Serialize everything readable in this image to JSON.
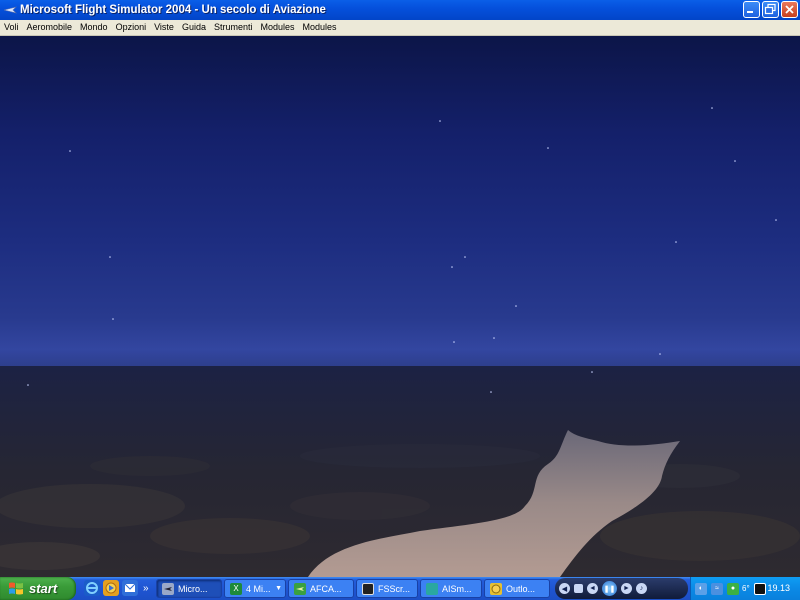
{
  "window": {
    "title": "Microsoft Flight Simulator 2004 - Un secolo di Aviazione",
    "buttons": [
      "minimize",
      "restore",
      "close"
    ]
  },
  "menu": {
    "items": [
      "Voli",
      "Aeromobile",
      "Mondo",
      "Opzioni",
      "Viste",
      "Guida",
      "Strumenti",
      "Modules",
      "Modules"
    ]
  },
  "taskbar": {
    "start_label": "start",
    "quick_launch": [
      "ie-icon",
      "media-icon",
      "outlook-icon"
    ],
    "quick_launch_more": "»",
    "tasks": [
      {
        "label": "Micro...",
        "icon": "flight-sim-icon",
        "active": true
      },
      {
        "label": "4 Mi...",
        "icon": "excel-icon",
        "active": false
      },
      {
        "label": "AFCA...",
        "icon": "afcad-icon",
        "active": false
      },
      {
        "label": "FSScr...",
        "icon": "fsscreen-icon",
        "active": false
      },
      {
        "label": "AISm...",
        "icon": "aismooth-icon",
        "active": false
      },
      {
        "label": "Outlo...",
        "icon": "outlook-icon",
        "active": false
      }
    ],
    "media_controls": [
      "prev",
      "stop",
      "rewind",
      "play-pause",
      "forward",
      "volume"
    ],
    "tray": {
      "temp": "6°",
      "clock": "19.13"
    }
  },
  "colors": {
    "titlebar": "#0550dc",
    "menubar": "#ece9d8",
    "taskbar": "#245edb",
    "start": "#3a9c39",
    "tray": "#0b8ae6",
    "sky_top": "#0c1548",
    "horizon": "#3346a0",
    "ground": "#1b1f32",
    "lake": "#a9958f"
  }
}
